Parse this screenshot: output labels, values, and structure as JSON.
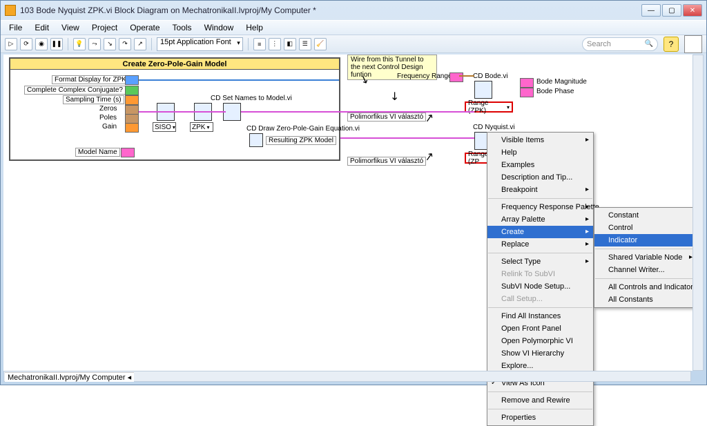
{
  "window": {
    "title": "103 Bode Nyquist ZPK.vi Block Diagram on MechatronikaII.lvproj/My Computer *"
  },
  "menubar": [
    "File",
    "Edit",
    "View",
    "Project",
    "Operate",
    "Tools",
    "Window",
    "Help"
  ],
  "toolbar": {
    "font": "15pt Application Font",
    "search_placeholder": "Search"
  },
  "struct_title": "Create Zero-Pole-Gain Model",
  "tips": {
    "wire": "Wire from this Tunnel to\nthe next Control Design funtion"
  },
  "labels": {
    "format_display": "Format Display for ZPK",
    "complete_conj": "Complete Complex Conjugate? (F)",
    "sampling_time": "Sampling Time (s)",
    "zeros": "Zeros",
    "poles": "Poles",
    "gain": "Gain",
    "model_name": "Model Name",
    "cd_set_names": "CD Set Names to Model.vi",
    "cd_draw_eq": "CD Draw Zero-Pole-Gain Equation.vi",
    "resulting": "Resulting ZPK Model",
    "freq_range": "Frequency Range",
    "cd_bode": "CD Bode.vi",
    "bode_mag": "Bode Magnitude",
    "bode_phase": "Bode Phase",
    "cd_nyquist": "CD Nyquist.vi",
    "poly1": "Polimorfikus VI választó",
    "poly2": "Polimorfikus VI választó"
  },
  "drops": {
    "siso": "SISO",
    "zpk": "ZPK",
    "range_zpk1": "Range (ZPK)",
    "range_zpk2": "Range (ZP"
  },
  "ctx1": {
    "items": [
      {
        "label": "Visible Items",
        "sub": true
      },
      {
        "label": "Help"
      },
      {
        "label": "Examples"
      },
      {
        "label": "Description and Tip..."
      },
      {
        "label": "Breakpoint",
        "sub": true
      },
      {
        "sep": true
      },
      {
        "label": "Frequency Response Palette",
        "sub": true
      },
      {
        "label": "Array Palette",
        "sub": true
      },
      {
        "label": "Create",
        "sub": true,
        "hi": true
      },
      {
        "label": "Replace",
        "sub": true
      },
      {
        "sep": true
      },
      {
        "label": "Select Type",
        "sub": true
      },
      {
        "label": "Relink To SubVI",
        "disabled": true
      },
      {
        "label": "SubVI Node Setup..."
      },
      {
        "label": "Call Setup...",
        "disabled": true
      },
      {
        "sep": true
      },
      {
        "label": "Find All Instances"
      },
      {
        "label": "Open Front Panel"
      },
      {
        "label": "Open Polymorphic VI"
      },
      {
        "label": "Show VI Hierarchy"
      },
      {
        "label": "Explore..."
      },
      {
        "sep": true
      },
      {
        "label": "View As Icon",
        "check": true
      },
      {
        "sep": true
      },
      {
        "label": "Remove and Rewire"
      },
      {
        "sep": true
      },
      {
        "label": "Properties"
      }
    ]
  },
  "ctx2": {
    "items": [
      {
        "label": "Constant"
      },
      {
        "label": "Control"
      },
      {
        "label": "Indicator",
        "hi": true
      },
      {
        "sep": true
      },
      {
        "label": "Shared Variable Node",
        "sub": true
      },
      {
        "label": "Channel Writer..."
      },
      {
        "sep": true
      },
      {
        "label": "All Controls and Indicators"
      },
      {
        "label": "All Constants"
      }
    ]
  },
  "statusbar": "MechatronikaII.lvproj/My Computer"
}
